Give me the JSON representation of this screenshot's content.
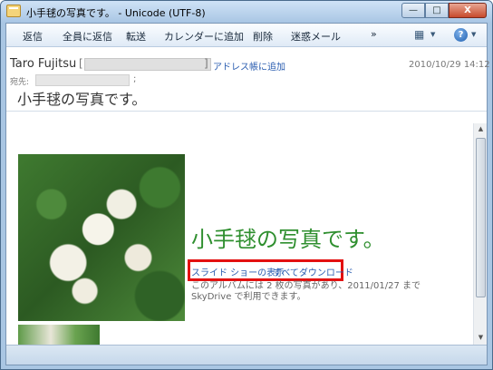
{
  "window": {
    "title": "小手毬の写真です。 - Unicode (UTF-8)",
    "minimize_glyph": "—",
    "maximize_glyph": "□",
    "close_glyph": "X"
  },
  "toolbar": {
    "reply": "返信",
    "reply_all": "全員に返信",
    "forward": "転送",
    "add_to_calendar": "カレンダーに追加",
    "delete": "削除",
    "junk": "迷惑メール",
    "more": "»",
    "tools_icon": "tools-icon",
    "help": "?"
  },
  "header": {
    "from_name": "Taro Fujitsu",
    "bracket_open": "[",
    "bracket_close": "]",
    "add_to_address_book": "アドレス帳に追加",
    "date": "2010/10/29 14:12",
    "to_label": "宛先:",
    "to_separator": ";",
    "subject": "小手毬の写真です。"
  },
  "body": {
    "album_title": "小手毬の写真です。",
    "slideshow_link": "スライド ショーの表示",
    "download_all_link": "すべてダウンロード",
    "description": "このアルバムには 2 枚の写真があり、2011/01/27 まで SkyDrive で利用できます。"
  },
  "colors": {
    "title_green": "#2f8f2f",
    "link_blue": "#2a5db0",
    "highlight_red": "#e31010"
  }
}
